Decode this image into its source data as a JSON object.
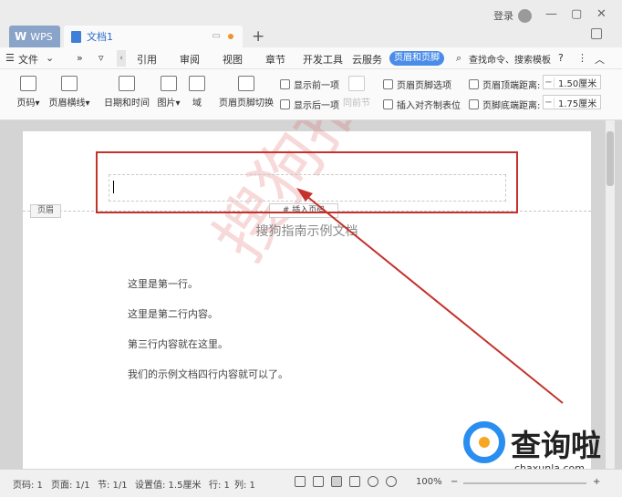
{
  "titlebar": {
    "app_tab": "WPS",
    "doc_tab": "文档1",
    "login": "登录"
  },
  "menu": {
    "file": "文件",
    "items": [
      "引用",
      "审阅",
      "视图",
      "章节",
      "开发工具",
      "云服务"
    ],
    "active": "页眉和页脚",
    "search": "查找命令、搜索模板"
  },
  "ribbon": {
    "page_number": "页码",
    "header_line": "页眉横线",
    "date_time": "日期和时间",
    "picture": "图片",
    "field": "域",
    "switch": "页眉页脚切换",
    "show_prev": "显示前一项",
    "show_next": "显示后一项",
    "same_as_prev": "同前节",
    "hf_options": "页眉页脚选项",
    "insert_tab": "插入对齐制表位",
    "header_top_label": "页眉顶端距离:",
    "header_top_value": "1.50厘米",
    "footer_bottom_label": "页脚底端距离:",
    "footer_bottom_value": "1.75厘米"
  },
  "document": {
    "header_tag": "页眉",
    "insert_page_button": "插入页码",
    "title": "搜狗指南示例文档",
    "lines": [
      "这里是第一行。",
      "这里是第二行内容。",
      "第三行内容就在这里。",
      "我们的示例文档四行内容就可以了。"
    ],
    "watermark": "搜狗指南"
  },
  "brand": {
    "name": "查询啦",
    "url": "chaxunla.com"
  },
  "status": {
    "page": "页码: 1",
    "pages": "页面: 1/1",
    "section": "节: 1/1",
    "setting": "设置值: 1.5厘米",
    "row": "行: 1",
    "col": "列: 1",
    "zoom": "100%"
  },
  "colors": {
    "accent": "#4a8ce8",
    "annotation": "#c4322d"
  }
}
